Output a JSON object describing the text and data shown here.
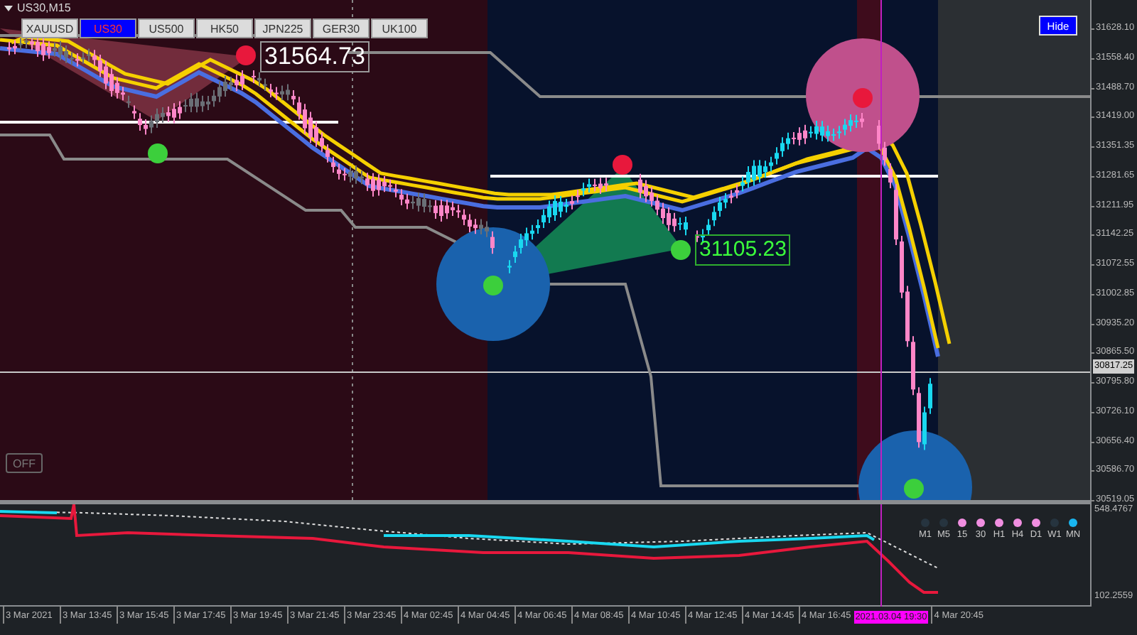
{
  "chart": {
    "title": "US30,M15"
  },
  "symbols": [
    {
      "label": "XAUUSD",
      "selected": false
    },
    {
      "label": "US30",
      "selected": true
    },
    {
      "label": "US500",
      "selected": false
    },
    {
      "label": "HK50",
      "selected": false
    },
    {
      "label": "JPN225",
      "selected": false
    },
    {
      "label": "GER30",
      "selected": false
    },
    {
      "label": "UK100",
      "selected": false
    }
  ],
  "hide_button": "Hide",
  "off_button": "OFF",
  "price_labels": [
    {
      "text": "31564.73",
      "kind": "high"
    },
    {
      "text": "31105.23",
      "kind": "low"
    }
  ],
  "price_axis": {
    "ticks": [
      "31628.10",
      "31558.40",
      "31488.70",
      "31419.00",
      "31351.35",
      "31281.65",
      "31211.95",
      "31142.25",
      "31072.55",
      "31002.85",
      "30935.20",
      "30865.50",
      "30795.80",
      "30726.10",
      "30656.40",
      "30586.70",
      "30519.05"
    ],
    "current_price": "30817.25"
  },
  "indicator_axis": {
    "max": "548.4767",
    "min": "102.2559"
  },
  "timeframes": [
    {
      "label": "M1",
      "color": "#26343f"
    },
    {
      "label": "M5",
      "color": "#26343f"
    },
    {
      "label": "15",
      "color": "#f08ee0"
    },
    {
      "label": "30",
      "color": "#f08ee0"
    },
    {
      "label": "H1",
      "color": "#f08ee0"
    },
    {
      "label": "H4",
      "color": "#f08ee0"
    },
    {
      "label": "D1",
      "color": "#f08ee0"
    },
    {
      "label": "W1",
      "color": "#26343f"
    },
    {
      "label": "MN",
      "color": "#19b6f0"
    }
  ],
  "time_axis": {
    "labels": [
      "3 Mar 2021",
      "3 Mar 13:45",
      "3 Mar 15:45",
      "3 Mar 17:45",
      "3 Mar 19:45",
      "3 Mar 21:45",
      "3 Mar 23:45",
      "4 Mar 02:45",
      "4 Mar 04:45",
      "4 Mar 06:45",
      "4 Mar 08:45",
      "4 Mar 10:45",
      "4 Mar 12:45",
      "4 Mar 14:45",
      "4 Mar 16:45",
      "4 Mar 20:45"
    ],
    "crosshair_time": "2021.03.04 19:30"
  }
}
